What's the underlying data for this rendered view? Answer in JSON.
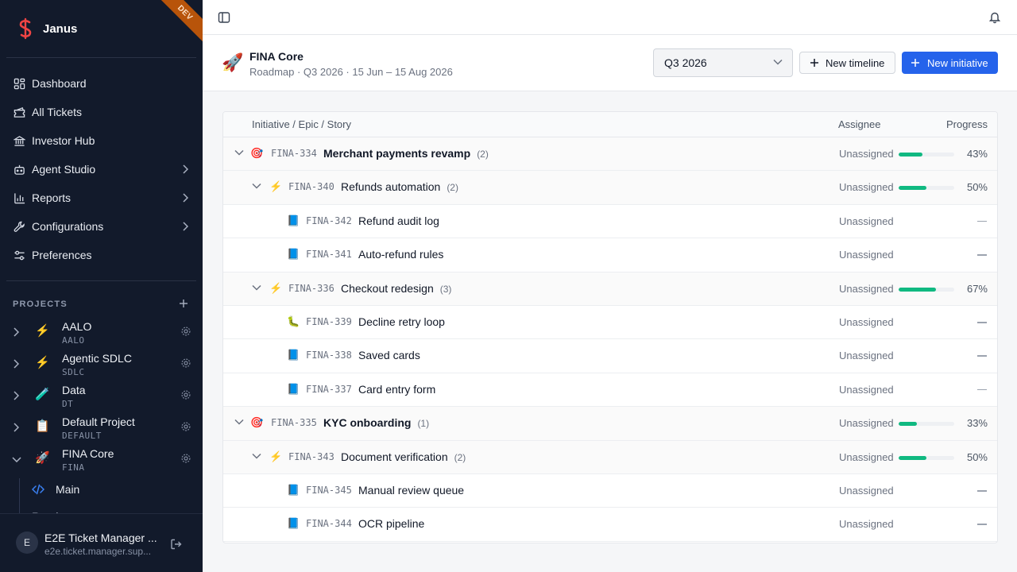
{
  "sidebar": {
    "app_name": "Janus",
    "env_badge": "DEV",
    "nav": [
      {
        "label": "Dashboard",
        "icon": "dashboard-icon"
      },
      {
        "label": "All Tickets",
        "icon": "tickets-icon"
      },
      {
        "label": "Investor Hub",
        "icon": "bank-icon"
      },
      {
        "label": "Agent Studio",
        "icon": "bot-icon",
        "expandable": true
      },
      {
        "label": "Reports",
        "icon": "chart-icon",
        "expandable": true
      },
      {
        "label": "Configurations",
        "icon": "wrench-icon",
        "expandable": true
      },
      {
        "label": "Preferences",
        "icon": "sliders-icon"
      }
    ],
    "projects_header": "PROJECTS",
    "projects": [
      {
        "name": "AALO",
        "code": "AALO",
        "icon": "⚡"
      },
      {
        "name": "Agentic SDLC",
        "code": "SDLC",
        "icon": "⚡"
      },
      {
        "name": "Data",
        "code": "DT",
        "icon": "🧪"
      },
      {
        "name": "Default Project",
        "code": "DEFAULT",
        "icon": "📋"
      },
      {
        "name": "FINA Core",
        "code": "FINA",
        "icon": "🚀",
        "expanded": true
      }
    ],
    "sub_items": [
      {
        "label": "Main",
        "icon": "code-icon"
      },
      {
        "label": "Roadmap",
        "icon": "map-icon"
      }
    ],
    "user": {
      "initial": "E",
      "name": "E2E Ticket Manager ...",
      "email": "e2e.ticket.manager.sup..."
    }
  },
  "header": {
    "icon": "🚀",
    "title": "FINA Core",
    "subtitle": "Roadmap · Q3 2026 · 15 Jun – 15 Aug 2026",
    "quarter": "Q3 2026",
    "new_timeline": "New timeline",
    "new_initiative": "New initiative"
  },
  "table": {
    "columns": {
      "title": "Initiative / Epic / Story",
      "assignee": "Assignee",
      "progress": "Progress"
    },
    "rows": [
      {
        "level": 0,
        "icon": "🎯",
        "key": "FINA-334",
        "name": "Merchant payments revamp",
        "count": "(2)",
        "assignee": "Unassigned",
        "progress": 0.43,
        "progress_label": "43%"
      },
      {
        "level": 1,
        "icon": "⚡",
        "key": "FINA-340",
        "name": "Refunds automation",
        "count": "(2)",
        "assignee": "Unassigned",
        "progress": 0.5,
        "progress_label": "50%"
      },
      {
        "level": 2,
        "icon": "📘",
        "key": "FINA-342",
        "name": "Refund audit log",
        "count": "",
        "assignee": "Unassigned",
        "progress": null,
        "progress_label": ""
      },
      {
        "level": 2,
        "icon": "📘",
        "key": "FINA-341",
        "name": "Auto-refund rules",
        "count": "",
        "assignee": "Unassigned",
        "progress": null,
        "progress_label": ""
      },
      {
        "level": 1,
        "icon": "⚡",
        "key": "FINA-336",
        "name": "Checkout redesign",
        "count": "(3)",
        "assignee": "Unassigned",
        "progress": 0.67,
        "progress_label": "67%"
      },
      {
        "level": 2,
        "icon": "🐛",
        "key": "FINA-339",
        "name": "Decline retry loop",
        "count": "",
        "assignee": "Unassigned",
        "progress": null,
        "progress_label": ""
      },
      {
        "level": 2,
        "icon": "📘",
        "key": "FINA-338",
        "name": "Saved cards",
        "count": "",
        "assignee": "Unassigned",
        "progress": null,
        "progress_label": ""
      },
      {
        "level": 2,
        "icon": "📘",
        "key": "FINA-337",
        "name": "Card entry form",
        "count": "",
        "assignee": "Unassigned",
        "progress": null,
        "progress_label": ""
      },
      {
        "level": 0,
        "icon": "🎯",
        "key": "FINA-335",
        "name": "KYC onboarding",
        "count": "(1)",
        "assignee": "Unassigned",
        "progress": 0.33,
        "progress_label": "33%"
      },
      {
        "level": 1,
        "icon": "⚡",
        "key": "FINA-343",
        "name": "Document verification",
        "count": "(2)",
        "assignee": "Unassigned",
        "progress": 0.5,
        "progress_label": "50%"
      },
      {
        "level": 2,
        "icon": "📘",
        "key": "FINA-345",
        "name": "Manual review queue",
        "count": "",
        "assignee": "Unassigned",
        "progress": null,
        "progress_label": ""
      },
      {
        "level": 2,
        "icon": "📘",
        "key": "FINA-344",
        "name": "OCR pipeline",
        "count": "",
        "assignee": "Unassigned",
        "progress": null,
        "progress_label": ""
      }
    ]
  },
  "colors": {
    "sidebar_bg": "#121a2b",
    "accent": "#2563eb",
    "progress": "#10b981",
    "logo": "#ef4444",
    "badge": "#b8540a"
  }
}
